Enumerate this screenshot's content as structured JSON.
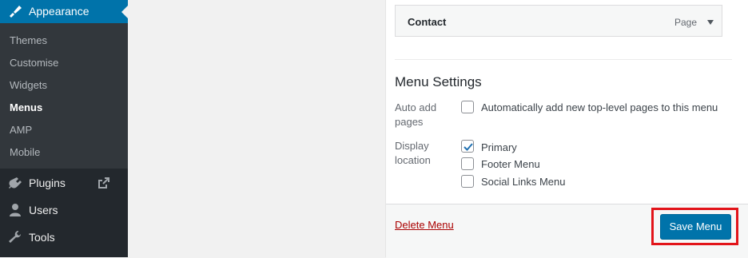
{
  "sidebar": {
    "current_menu": {
      "label": "Appearance",
      "icon": "paintbrush-icon"
    },
    "submenu": [
      {
        "label": "Themes",
        "current": false
      },
      {
        "label": "Customise",
        "current": false
      },
      {
        "label": "Widgets",
        "current": false
      },
      {
        "label": "Menus",
        "current": true
      },
      {
        "label": "AMP",
        "current": false
      },
      {
        "label": "Mobile",
        "current": false
      }
    ],
    "items": [
      {
        "label": "Plugins",
        "icon": "plugin-icon",
        "extra_icon": "external-link-icon"
      },
      {
        "label": "Users",
        "icon": "user-icon"
      },
      {
        "label": "Tools",
        "icon": "wrench-icon"
      }
    ],
    "colors": {
      "background": "#23282d",
      "submenu": "#32373c",
      "accent": "#0073aa"
    }
  },
  "menu_item": {
    "title": "Contact",
    "type": "Page"
  },
  "menu_settings": {
    "title": "Menu Settings",
    "auto_add": {
      "label_line1": "Auto add",
      "label_line2": "pages",
      "option": "Automatically add new top-level pages to this menu",
      "checked": false
    },
    "display_location": {
      "label_line1": "Display",
      "label_line2": "location",
      "options": [
        {
          "label": "Primary",
          "checked": true
        },
        {
          "label": "Footer Menu",
          "checked": false
        },
        {
          "label": "Social Links Menu",
          "checked": false
        }
      ]
    }
  },
  "footer": {
    "delete_label": "Delete Menu",
    "save_label": "Save Menu",
    "highlight_color": "#e2141a"
  }
}
